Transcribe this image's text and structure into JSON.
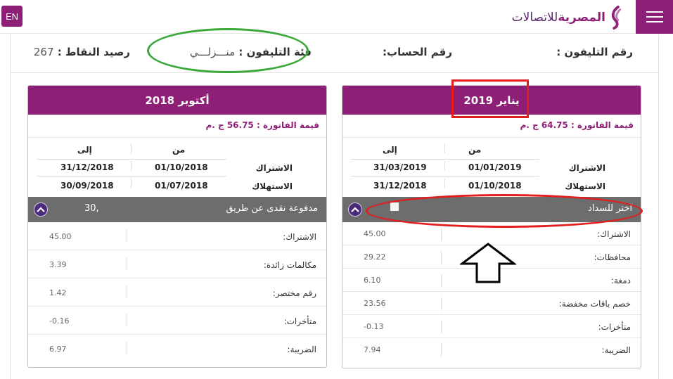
{
  "header": {
    "lang_button": "EN",
    "logo_text_main": "المصرية",
    "logo_text_sub": "للاتصالات"
  },
  "info": {
    "phone_label": "رقم التليفون :",
    "account_label": "رقم الحساب:",
    "category_label": "فئة التليفون :",
    "category_value": "منـــزلـــي",
    "points_label": "رصيد النقاط :",
    "points_value": "267"
  },
  "cards": [
    {
      "title": "يناير 2019",
      "bill_amount": "قيمة الفاتورة : 64.75 ج .م",
      "col_from": "من",
      "col_to": "إلى",
      "rows": [
        {
          "label": "الاشتراك",
          "from": "01/01/2019",
          "to": "31/03/2019"
        },
        {
          "label": "الاستهلاك",
          "from": "01/10/2018",
          "to": "31/12/2018"
        }
      ],
      "pay_label": "اختر للسداد",
      "details": [
        {
          "k": "الاشتراك:",
          "v": "45.00"
        },
        {
          "k": "محافظات:",
          "v": "29.22"
        },
        {
          "k": "دمغة:",
          "v": "6.10"
        },
        {
          "k": "خصم باقات مخفضة:",
          "v": "23.56"
        },
        {
          "k": "متأخرات:",
          "v": "-0.13"
        },
        {
          "k": "الضريبة:",
          "v": "7.94"
        }
      ]
    },
    {
      "title": "أكتوبر 2018",
      "bill_amount": "قيمة الفاتورة : 56.75 ج .م",
      "col_from": "من",
      "col_to": "إلى",
      "rows": [
        {
          "label": "الاشتراك",
          "from": "01/10/2018",
          "to": "31/12/2018"
        },
        {
          "label": "الاستهلاك",
          "from": "01/07/2018",
          "to": "30/09/2018"
        }
      ],
      "pay_label": "مدفوعة نقدى عن طريق",
      "pay_amount": "30,",
      "details": [
        {
          "k": "الاشتراك:",
          "v": "45.00"
        },
        {
          "k": "مكالمات زائدة:",
          "v": "3.39"
        },
        {
          "k": "رقم مختصر:",
          "v": "1.42"
        },
        {
          "k": "متأخرات:",
          "v": "-0.16"
        },
        {
          "k": "الضريبة:",
          "v": "6.97"
        }
      ]
    }
  ],
  "colors": {
    "brand": "#8e1f77",
    "pay_bar": "#6d6d6d",
    "annotation_red": "#e21d1d",
    "annotation_green": "#3aa83a"
  }
}
